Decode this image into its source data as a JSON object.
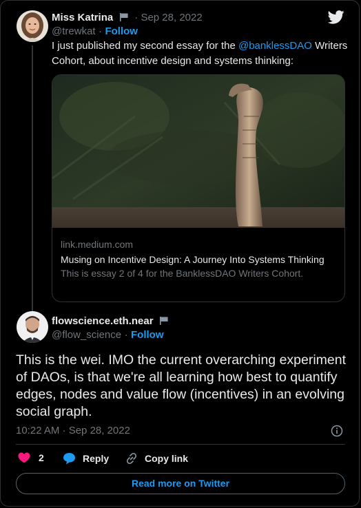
{
  "tweet1": {
    "author": "Miss Katrina",
    "date": "Sep 28, 2022",
    "handle": "@trewkat",
    "follow": "Follow",
    "text_before": "I just published my second essay for the ",
    "mention": "@banklessDAO",
    "text_after": " Writers Cohort, about incentive design and systems thinking:",
    "card": {
      "domain": "link.medium.com",
      "title": "Musing on Incentive Design: A Journey Into Systems Thinking",
      "description": "This is essay 2 of 4 for the BanklessDAO Writers Cohort."
    }
  },
  "tweet2": {
    "author": "flowscience.eth.near",
    "handle": "@flow_science",
    "follow": "Follow",
    "text": "This is the wei. IMO the current overarching experiment of DAOs, is that we're all learning how best to quantify edges, nodes and value flow (incentives) in an evolving social graph.",
    "timestamp": "10:22 AM · Sep 28, 2022",
    "likes": "2",
    "reply": "Reply",
    "copy_link": "Copy link",
    "read_more": "Read more on Twitter"
  },
  "icons": {
    "twitter": "twitter-bird-icon",
    "flag": "flag-icon",
    "info": "info-icon",
    "heart": "heart-icon",
    "reply": "reply-bubble-icon",
    "link": "link-icon"
  },
  "colors": {
    "accent": "#1d9bf0",
    "like": "#f91880",
    "background": "#000000"
  }
}
